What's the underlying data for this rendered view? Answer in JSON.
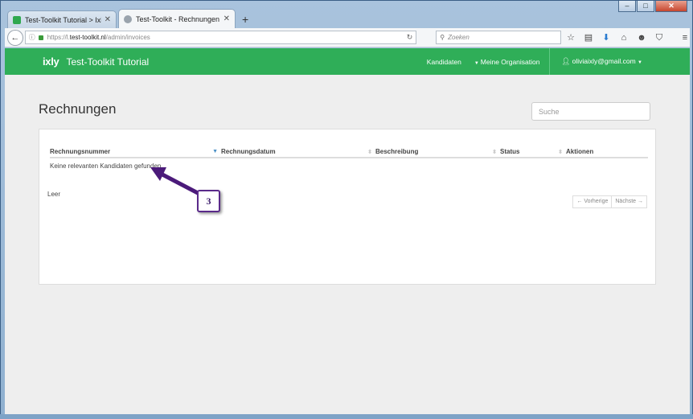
{
  "browser": {
    "tabs": [
      {
        "title": "Test-Toolkit Tutorial > Ixly",
        "active": false,
        "favicon": "ixly-favicon"
      },
      {
        "title": "Test-Toolkit - Rechnungen",
        "active": true,
        "favicon": "page-favicon"
      }
    ],
    "new_tab": "+",
    "window_controls": {
      "minimize": "–",
      "maximize": "□",
      "close": "✕"
    },
    "url": {
      "prefix": "https://l.",
      "host": "test-toolkit.nl",
      "path": "/admin/invoices"
    },
    "search_placeholder": "Zoeken",
    "icons": [
      "star-icon",
      "clipboard-icon",
      "download-icon",
      "home-icon",
      "chat-icon",
      "pocket-icon",
      "menu-icon"
    ]
  },
  "app": {
    "logo": "ixly",
    "title": "Test-Toolkit Tutorial",
    "nav": {
      "candidates": "Kandidaten",
      "organisation": "Meine Organisation",
      "user": "oliviaixly@gmail.com"
    },
    "accent_color": "#2fae58"
  },
  "main": {
    "page_title": "Rechnungen",
    "search_placeholder": "Suche",
    "table": {
      "columns": [
        "Rechnungsnummer",
        "Rechnungsdatum",
        "Beschreibung",
        "Status",
        "Aktionen"
      ],
      "empty_message": "Keine relevanten Kandidaten gefunden"
    },
    "info": "Leer",
    "pagination": {
      "prev": "← Vorherige",
      "next": "Nächste →"
    }
  },
  "annotation": {
    "label": "3",
    "color": "#4b1a7a"
  }
}
